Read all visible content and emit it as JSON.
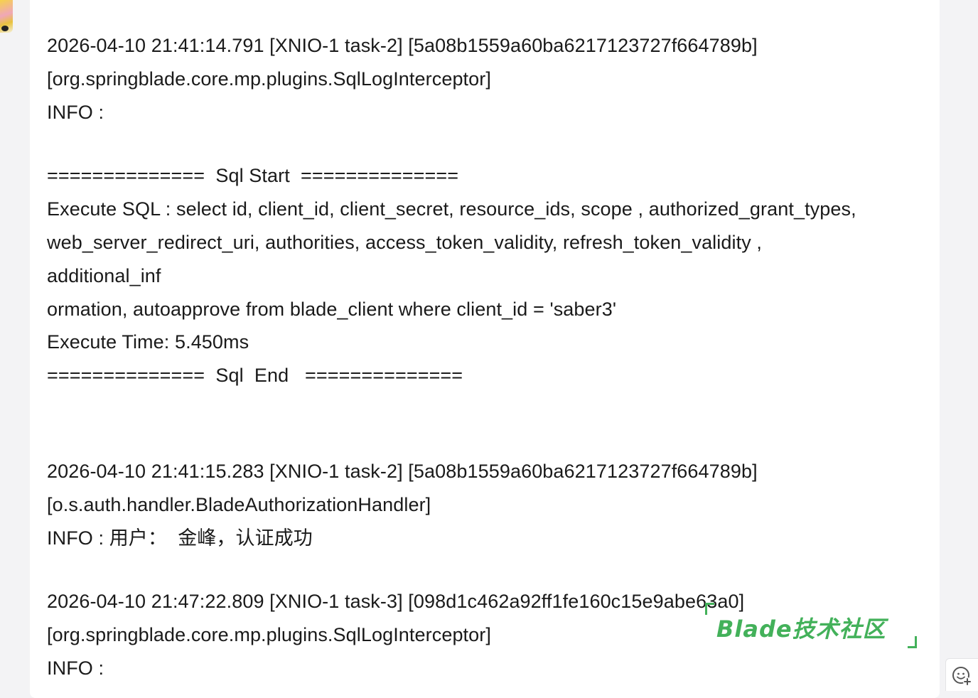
{
  "log": {
    "lines": [
      "2026-04-10 21:41:14.791 [XNIO-1 task-2] [5a08b1559a60ba6217123727f664789b]",
      "[org.springblade.core.mp.plugins.SqlLogInterceptor]",
      "INFO :",
      "",
      "==============  Sql Start  ==============",
      "Execute SQL : select id, client_id, client_secret, resource_ids, scope , authorized_grant_types,",
      "web_server_redirect_uri, authorities, access_token_validity, refresh_token_validity ,",
      "additional_inf",
      "ormation, autoapprove from blade_client where client_id = 'saber3'",
      "Execute Time: 5.450ms",
      "==============  Sql  End   ==============",
      "",
      "2026-04-10 21:41:15.283 [XNIO-1 task-2] [5a08b1559a60ba6217123727f664789b]",
      "[o.s.auth.handler.BladeAuthorizationHandler]",
      "INFO : 用户：  金峰，认证成功",
      "",
      "2026-04-10 21:47:22.809 [XNIO-1 task-3] [098d1c462a92ff1fe160c15e9abe63a0]",
      "[org.springblade.core.mp.plugins.SqlLogInterceptor]",
      "INFO :"
    ]
  },
  "watermark": {
    "text": "Blade技术社区"
  },
  "colors": {
    "text": "#1a1a1a",
    "watermark": "#43b15a",
    "background": "#f3f3f5",
    "bubble": "#ffffff"
  },
  "icons": {
    "side_button": "emoji-add-icon"
  }
}
